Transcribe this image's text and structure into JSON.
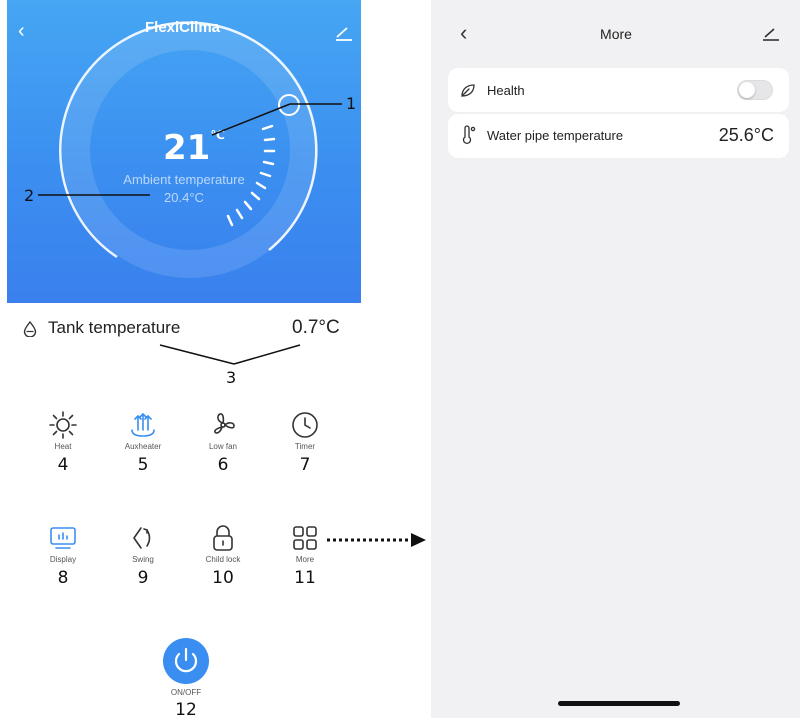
{
  "left": {
    "app_title": "FlexiClima",
    "set_temp": "21",
    "set_temp_unit": "℃",
    "ambient_label": "Ambient temperature",
    "ambient_value": "20.4°C",
    "tank_label": "Tank temperature",
    "tank_value": "0.7°C",
    "controls": [
      {
        "label": "Heat",
        "num": "4",
        "icon": "sun-icon"
      },
      {
        "label": "Auxheater",
        "num": "5",
        "icon": "auxheater-icon"
      },
      {
        "label": "Low fan",
        "num": "6",
        "icon": "fan-icon"
      },
      {
        "label": "Timer",
        "num": "7",
        "icon": "clock-icon"
      },
      {
        "label": "Display",
        "num": "8",
        "icon": "display-icon"
      },
      {
        "label": "Swing",
        "num": "9",
        "icon": "swing-icon"
      },
      {
        "label": "Child lock",
        "num": "10",
        "icon": "lock-icon"
      },
      {
        "label": "More",
        "num": "11",
        "icon": "grid-icon"
      }
    ],
    "power": {
      "label": "ON/OFF",
      "num": "12"
    },
    "callouts": {
      "c1": "1",
      "c2": "2",
      "c3": "3"
    }
  },
  "right": {
    "title": "More",
    "health_label": "Health",
    "health_on": false,
    "pipe_label": "Water pipe temperature",
    "pipe_value": "25.6°C"
  },
  "colors": {
    "hero": "#3b8ff0",
    "accent": "#3a8ef2",
    "panel": "#f1f1f3"
  }
}
